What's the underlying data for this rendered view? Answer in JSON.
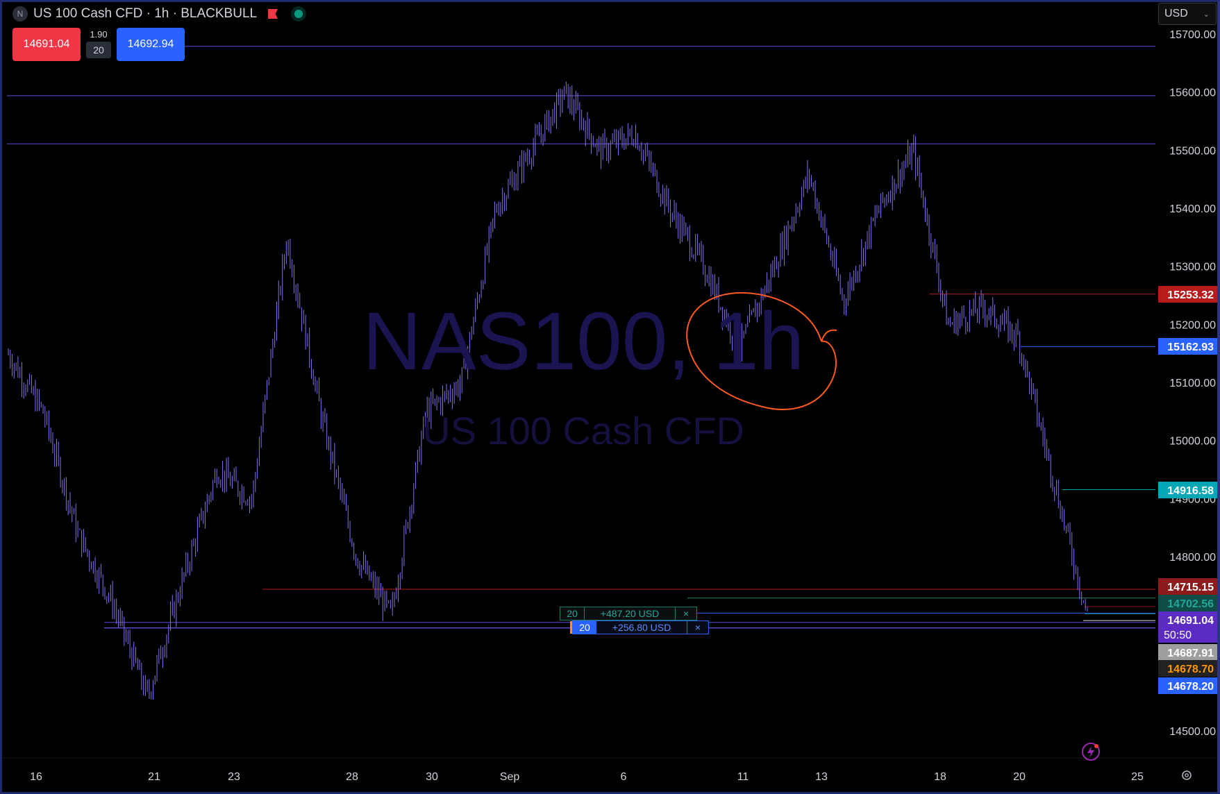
{
  "header": {
    "symbol_badge": "N",
    "title": "US 100 Cash CFD · 1h · BLACKBULL"
  },
  "trade_panel": {
    "sell_price": "14691.04",
    "spread": "1.90",
    "quantity": "20",
    "buy_price": "14692.94"
  },
  "currency": "USD",
  "watermark": {
    "symbol": "NAS100, 1h",
    "description": "US 100 Cash CFD"
  },
  "positions": [
    {
      "qty": "20",
      "pl": "+487.20 USD",
      "close": "×"
    },
    {
      "qty": "20",
      "pl": "+256.80 USD",
      "close": "×"
    }
  ],
  "colors": {
    "candle": "#8a6ff0",
    "hline": "#5a4fd6",
    "annotation": "#ff5a1f",
    "red_line": "#b71c1c",
    "blue_line": "#2962ff",
    "teal_line": "#00a8b5"
  },
  "chart_data": {
    "type": "candlestick",
    "y_axis": {
      "min": 14450,
      "max": 15725,
      "ticks": [
        "15700.00",
        "15600.00",
        "15500.00",
        "15400.00",
        "15300.00",
        "15200.00",
        "15100.00",
        "15000.00",
        "14900.00",
        "14800.00",
        "14500.00"
      ]
    },
    "x_axis": {
      "ticks": [
        "16",
        "21",
        "23",
        "28",
        "30",
        "Sep",
        "6",
        "11",
        "13",
        "18",
        "20",
        "25"
      ]
    },
    "price_path": [
      [
        "16",
        15150
      ],
      [
        "17",
        15050
      ],
      [
        "18",
        14840
      ],
      [
        "19",
        14720
      ],
      [
        "20",
        14560
      ],
      [
        "21",
        14760
      ],
      [
        "22",
        14950
      ],
      [
        "23",
        14900
      ],
      [
        "24",
        15350
      ],
      [
        "25",
        15040
      ],
      [
        "26",
        14800
      ],
      [
        "27",
        14700
      ],
      [
        "28",
        15050
      ],
      [
        "29",
        15100
      ],
      [
        "30",
        15400
      ],
      [
        "31",
        15500
      ],
      [
        "Sep",
        15600
      ],
      [
        "2",
        15500
      ],
      [
        "5",
        15530
      ],
      [
        "6",
        15400
      ],
      [
        "7",
        15300
      ],
      [
        "8",
        15160
      ],
      [
        "11",
        15300
      ],
      [
        "12",
        15460
      ],
      [
        "13",
        15240
      ],
      [
        "14",
        15400
      ],
      [
        "15",
        15500
      ],
      [
        "18",
        15200
      ],
      [
        "19",
        15230
      ],
      [
        "20",
        15180
      ],
      [
        "21",
        14940
      ],
      [
        "22",
        14700
      ]
    ],
    "horizontal_lines": [
      {
        "label": "",
        "price": 15680
      },
      {
        "label": "",
        "price": 15595
      },
      {
        "label": "",
        "price": 15512
      },
      {
        "label": "15253.32",
        "price": 15253.32
      },
      {
        "label": "15162.93",
        "price": 15162.93
      },
      {
        "label": "14916.58",
        "price": 14916.58
      },
      {
        "label": "14715.15",
        "price": 14715.15
      },
      {
        "label": "14702.56",
        "price": 14702.56
      },
      {
        "label": "14691.04",
        "price": 14691.04
      },
      {
        "label": "14687.91",
        "price": 14687.91
      },
      {
        "label": "14678.70",
        "price": 14678.7
      },
      {
        "label": "14678.20",
        "price": 14678.2
      }
    ],
    "price_labels": [
      {
        "text": "15253.32",
        "bg": "#b71c1c",
        "fg": "#ffffff"
      },
      {
        "text": "15162.93",
        "bg": "#2962ff",
        "fg": "#ffffff"
      },
      {
        "text": "14916.58",
        "bg": "#00a8b5",
        "fg": "#ffffff"
      },
      {
        "text": "14715.15",
        "bg": "#8e1b1b",
        "fg": "#ffffff"
      },
      {
        "text": "14702.56",
        "bg": "#0e4d45",
        "fg": "#26a69a"
      },
      {
        "text": "14691.04",
        "bg": "#5b2bc4",
        "fg": "#ffffff"
      },
      {
        "text": "50:50",
        "bg": "#5b2bc4",
        "fg": "#ffffff"
      },
      {
        "text": "14687.91",
        "bg": "#9e9e9e",
        "fg": "#ffffff"
      },
      {
        "text": "14678.70",
        "bg": "#222222",
        "fg": "#ff9800"
      },
      {
        "text": "14678.20",
        "bg": "#2962ff",
        "fg": "#ffffff"
      }
    ]
  }
}
